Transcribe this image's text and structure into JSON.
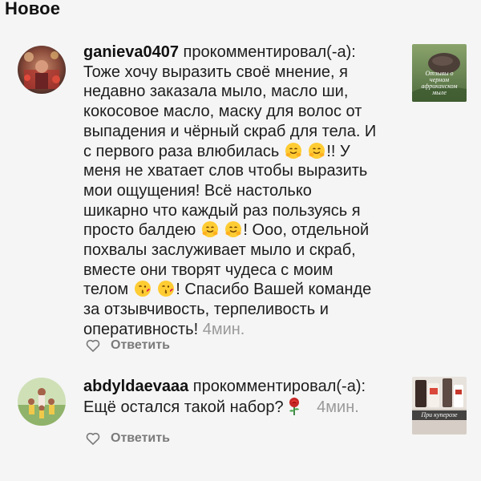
{
  "header": {
    "title": "Новое"
  },
  "comments": [
    {
      "username": "ganieva0407",
      "action": " прокомментировал(-а):",
      "lines": [
        "Тоже хочу выразить своё мнение, я",
        "недавно заказала мыло, масло ши,",
        "кокосовое масло, маску для волос от",
        "выпадения и чёрный скраб для тела. И",
        "с первого раза влюбилась",
        "!! У",
        "меня не хватает слов чтобы выразить",
        "мои ощущения! Всё настолько",
        "шикарно что каждый раз пользуясь я",
        "просто балдею",
        "! Ооо, отдельной",
        "похвалы заслуживает мыло и скраб,",
        "вместе они творят чудеса с моим",
        "телом",
        "! Спасибо Вашей команде",
        "за отзывчивость, терпеливость и",
        "оперативность!"
      ],
      "time": "4мин.",
      "reply_label": "Ответить",
      "thumbnail_caption": "Отзывы о черном африканском мыле",
      "icons": [
        "avatar-photo",
        "hugging-face-emoji",
        "kissing-face-emoji",
        "heart-icon",
        "post-thumbnail"
      ]
    },
    {
      "username": "abdyldaevaaa",
      "action": " прокомментировал(-а):",
      "lines": [
        "Ещё остался такой набор?"
      ],
      "time": "4мин.",
      "reply_label": "Ответить",
      "thumbnail_caption": "При куперозе",
      "icons": [
        "avatar-photo",
        "rose-emoji",
        "heart-icon",
        "post-thumbnail"
      ]
    }
  ],
  "colors": {
    "background": "#f5f5f5",
    "text": "#1d1d1d",
    "muted": "#9a9a9a",
    "reply": "#7a7a7a"
  }
}
